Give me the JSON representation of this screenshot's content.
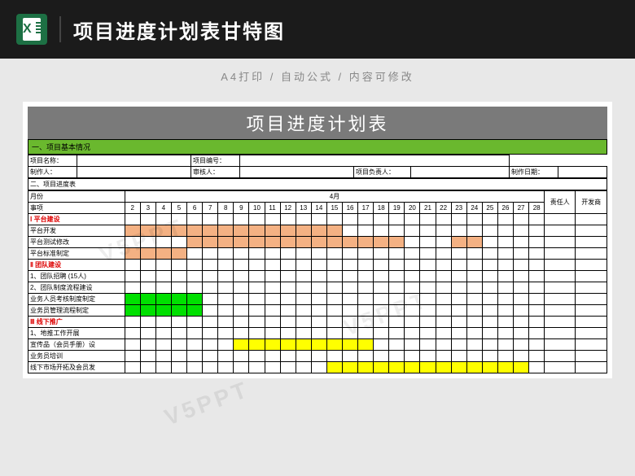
{
  "header": {
    "title": "项目进度计划表甘特图",
    "subtitle": "A4打印 / 自动公式 / 内容可修改"
  },
  "sheet": {
    "main_title": "项目进度计划表",
    "section1": "一、项目基本情况",
    "info": {
      "proj_name_lbl": "项目名称：",
      "proj_no_lbl": "项目编号：",
      "creator_lbl": "制作人：",
      "reviewer_lbl": "审核人：",
      "owner_lbl": "项目负责人：",
      "date_lbl": "制作日期："
    },
    "section2": "二、项目进度表",
    "month_lbl": "月份",
    "item_lbl": "事项",
    "month": "4月",
    "resp_lbl": "责任人",
    "dev_lbl": "开发商",
    "days": [
      "2",
      "3",
      "4",
      "5",
      "6",
      "7",
      "8",
      "9",
      "10",
      "11",
      "12",
      "13",
      "14",
      "15",
      "16",
      "17",
      "18",
      "19",
      "20",
      "21",
      "22",
      "23",
      "24",
      "25",
      "26",
      "27",
      "28"
    ],
    "groups": [
      {
        "name": "Ⅰ 平台建设",
        "tasks": [
          {
            "name": "平台开发",
            "bars": [
              {
                "s": 0,
                "e": 14,
                "c": "orange"
              }
            ]
          },
          {
            "name": "平台测试修改",
            "bars": [
              {
                "s": 4,
                "e": 18,
                "c": "orange"
              },
              {
                "s": 21,
                "e": 23,
                "c": "orange"
              }
            ]
          },
          {
            "name": "平台标准制定",
            "bars": [
              {
                "s": 0,
                "e": 4,
                "c": "orange"
              }
            ]
          }
        ]
      },
      {
        "name": "Ⅱ 团队建设",
        "tasks": [
          {
            "name": "1、团队招聘 (15人)",
            "bars": []
          },
          {
            "name": "2、团队制度流程建设",
            "bars": []
          },
          {
            "name": "业务人员考核制度制定",
            "bars": [
              {
                "s": 0,
                "e": 5,
                "c": "green"
              }
            ]
          },
          {
            "name": "业务员管理流程制定",
            "bars": [
              {
                "s": 0,
                "e": 5,
                "c": "green"
              }
            ]
          }
        ]
      },
      {
        "name": "Ⅲ 线下推广",
        "tasks": [
          {
            "name": "1、地推工作开展",
            "bars": []
          },
          {
            "name": "宣传品（会员手册）设",
            "bars": [
              {
                "s": 7,
                "e": 16,
                "c": "yellow"
              }
            ]
          },
          {
            "name": "业务员培训",
            "bars": []
          },
          {
            "name": "线下市场开拓及会员发",
            "bars": [
              {
                "s": 13,
                "e": 26,
                "c": "yellow"
              }
            ]
          }
        ]
      }
    ]
  },
  "watermark": "V5PPT",
  "chart_data": {
    "type": "gantt",
    "title": "项目进度计划表",
    "x_axis": {
      "label": "4月",
      "range": [
        2,
        28
      ],
      "ticks": [
        2,
        3,
        4,
        5,
        6,
        7,
        8,
        9,
        10,
        11,
        12,
        13,
        14,
        15,
        16,
        17,
        18,
        19,
        20,
        21,
        22,
        23,
        24,
        25,
        26,
        27,
        28
      ]
    },
    "columns": [
      "责任人",
      "开发商"
    ],
    "groups": [
      {
        "name": "Ⅰ 平台建设",
        "color": "#f4b183",
        "tasks": [
          {
            "name": "平台开发",
            "start": 2,
            "end": 16
          },
          {
            "name": "平台测试修改",
            "segments": [
              {
                "start": 6,
                "end": 20
              },
              {
                "start": 23,
                "end": 25
              }
            ]
          },
          {
            "name": "平台标准制定",
            "start": 2,
            "end": 6
          }
        ]
      },
      {
        "name": "Ⅱ 团队建设",
        "color": "#00e000",
        "tasks": [
          {
            "name": "1、团队招聘 (15人)"
          },
          {
            "name": "2、团队制度流程建设"
          },
          {
            "name": "业务人员考核制度制定",
            "start": 2,
            "end": 7
          },
          {
            "name": "业务员管理流程制定",
            "start": 2,
            "end": 7
          }
        ]
      },
      {
        "name": "Ⅲ 线下推广",
        "color": "#ffff00",
        "tasks": [
          {
            "name": "1、地推工作开展"
          },
          {
            "name": "宣传品（会员手册）设",
            "start": 9,
            "end": 18
          },
          {
            "name": "业务员培训"
          },
          {
            "name": "线下市场开拓及会员发",
            "start": 15,
            "end": 28
          }
        ]
      }
    ]
  }
}
